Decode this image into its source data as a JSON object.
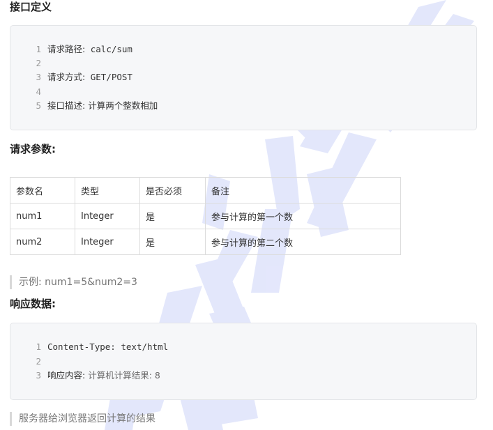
{
  "sections": {
    "interface_def_title": "接口定义",
    "request_params_title": "请求参数:",
    "response_data_title": "响应数据:"
  },
  "interface_code": [
    {
      "num": "1",
      "label": "请求路径:",
      "value": " calc/sum"
    },
    {
      "num": "2",
      "label": "",
      "value": ""
    },
    {
      "num": "3",
      "label": "请求方式:",
      "value": " GET/POST"
    },
    {
      "num": "4",
      "label": "",
      "value": ""
    },
    {
      "num": "5",
      "label": "接口描述:",
      "value": " 计算两个整数相加"
    }
  ],
  "params_table": {
    "headers": [
      "参数名",
      "类型",
      "是否必须",
      "备注"
    ],
    "rows": [
      [
        "num1",
        "Integer",
        "是",
        "参与计算的第一个数"
      ],
      [
        "num2",
        "Integer",
        "是",
        "参与计算的第二个数"
      ]
    ]
  },
  "example_note": "示例: num1=5&num2=3",
  "response_code": [
    {
      "num": "1",
      "label": "Content-Type:",
      "value": " text/html"
    },
    {
      "num": "2",
      "label": "",
      "value": ""
    },
    {
      "num": "3",
      "label": "响应内容:",
      "value": " 计算机计算结果: 8"
    }
  ],
  "response_note": "服务器给浏览器返回计算的结果"
}
